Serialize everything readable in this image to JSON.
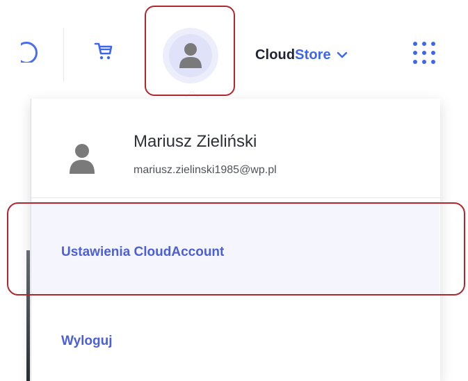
{
  "header": {
    "brand_cloud": "Cloud",
    "brand_store": "Store",
    "icons": {
      "cart": "shopping-cart-icon",
      "avatar": "user-avatar-icon",
      "apps": "app-grid-icon",
      "chevron": "chevron-down-icon"
    }
  },
  "account_menu": {
    "user_name": "Mariusz Zieliński",
    "user_email": "mariusz.zielinski1985@wp.pl",
    "items": [
      {
        "label": "Ustawienia CloudAccount"
      },
      {
        "label": "Wyloguj"
      }
    ]
  },
  "colors": {
    "accent": "#3d66ee",
    "menu_link": "#4c5fd6",
    "highlight": "#b0272e"
  }
}
